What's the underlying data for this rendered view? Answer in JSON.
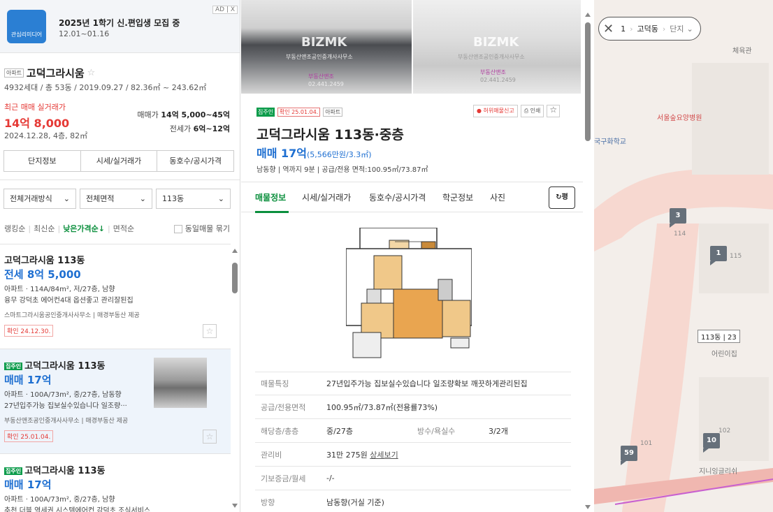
{
  "ad": {
    "logo_text": "관심리미디어",
    "title": "2025년 1학기 신.편입생 모집 중",
    "date": "12.01~01.16",
    "badge": "AD | X"
  },
  "complex": {
    "type_tag": "아파트",
    "name": "고덕그라시움",
    "meta": "4932세대 / 총 53동 / 2019.09.27 / 82.36㎡ ~ 243.62㎡",
    "recent_label": "최근 매매 실거래가",
    "recent_price": "14억 8,000",
    "recent_date": "2024.12.28, 4층, 82㎡",
    "sale_label": "매매가",
    "sale_range": "14억 5,000~45억",
    "lease_label": "전세가",
    "lease_range": "6억~12억",
    "buttons": [
      "단지정보",
      "시세/실거래가",
      "동호수/공시가격"
    ]
  },
  "filters": {
    "trade": "전체거래방식",
    "area": "전체면적",
    "building": "113동"
  },
  "sort": {
    "options": [
      "랭킹순",
      "최신순",
      "낮은가격순↓",
      "면적순"
    ],
    "group_label": "동일매물 묶기"
  },
  "listings": [
    {
      "title": "고덕그라시움 113동",
      "price": "전세 8억 5,000",
      "line1": "아파트 · 114A/84m², 저/27층, 남향",
      "line2": "융무 강덕초 에어컨4대 옵션좋고 관리잘된집",
      "source": "스마트그라시움공인중개사사무소 | 매경부동산 제공",
      "confirm": "확인 24.12.30."
    },
    {
      "direct": "집주인",
      "title": "고덕그라시움 113동",
      "price": "매매 17억",
      "line1": "아파트 · 100A/73m², 중/27층, 남동향",
      "line2": "27년입주가능 집보실수있습니다 일조량···",
      "source": "부동산앤조공인중개사사무소 | 매경부동산 제공",
      "confirm": "확인 25.01.04."
    },
    {
      "direct": "집주인",
      "title": "고덕그라시움 113동",
      "price": "매매 17억",
      "line1": "아파트 · 100A/73m², 중/27층, 남향",
      "line2": "추천 더블 역세권 시스템에어컨 강덕초 조식서비스"
    }
  ],
  "photos": {
    "watermark": "BIZMK",
    "sub": "부동산앤조공인중개사사무소",
    "pink": "부동산앤조",
    "phone": "02.441.2459"
  },
  "detail": {
    "badge_direct": "집주인",
    "badge_confirm": "확인 25.01.04.",
    "badge_type": "아파트",
    "report": "허위매물신고",
    "print": "인쇄",
    "title": "고덕그라시움 113동·중층",
    "price": "매매 17억",
    "price_per": "(5,566만원/3.3㎡)",
    "meta": "남동향 | 역까지 9분 | 공급/전용 면적:100.95㎡/73.87㎡",
    "tabs": [
      "매물정보",
      "시세/실거래가",
      "동호수/공시가격",
      "학군정보",
      "사진"
    ],
    "pyeong_btn": "평",
    "rows": [
      {
        "k": "매물특징",
        "v": "27년입주가능 집보실수있습니다 일조량확보 깨끗하게관리된집"
      },
      {
        "k": "공급/전용면적",
        "v": "100.95㎡/73.87㎡(전용률73%)"
      },
      {
        "k": "해당층/총층",
        "v": "중/27층",
        "k2": "방수/욕실수",
        "v2": "3/2개"
      },
      {
        "k": "관리비",
        "v": "31만 275원",
        "link": "상세보기"
      },
      {
        "k": "기보증금/월세",
        "v": "-/-"
      },
      {
        "k": "방향",
        "v": "남동향(거실 기준)"
      }
    ]
  },
  "map": {
    "breadcrumb_prefix": "1",
    "dong": "고덕동",
    "danji": "단지",
    "pins": [
      "3",
      "1",
      "10",
      "59"
    ],
    "labels": [
      "114",
      "115",
      "101",
      "102"
    ],
    "label113": "113동 | 23",
    "pois": [
      "체육관",
      "서울숲요양병원",
      "국구화학교",
      "지니잉글리쉬",
      "어린이집"
    ]
  },
  "colors": {
    "accent_green": "#0b8f3d",
    "price_blue": "#1e6fd1",
    "alert_red": "#e53935",
    "pin_gray": "#66707a"
  }
}
